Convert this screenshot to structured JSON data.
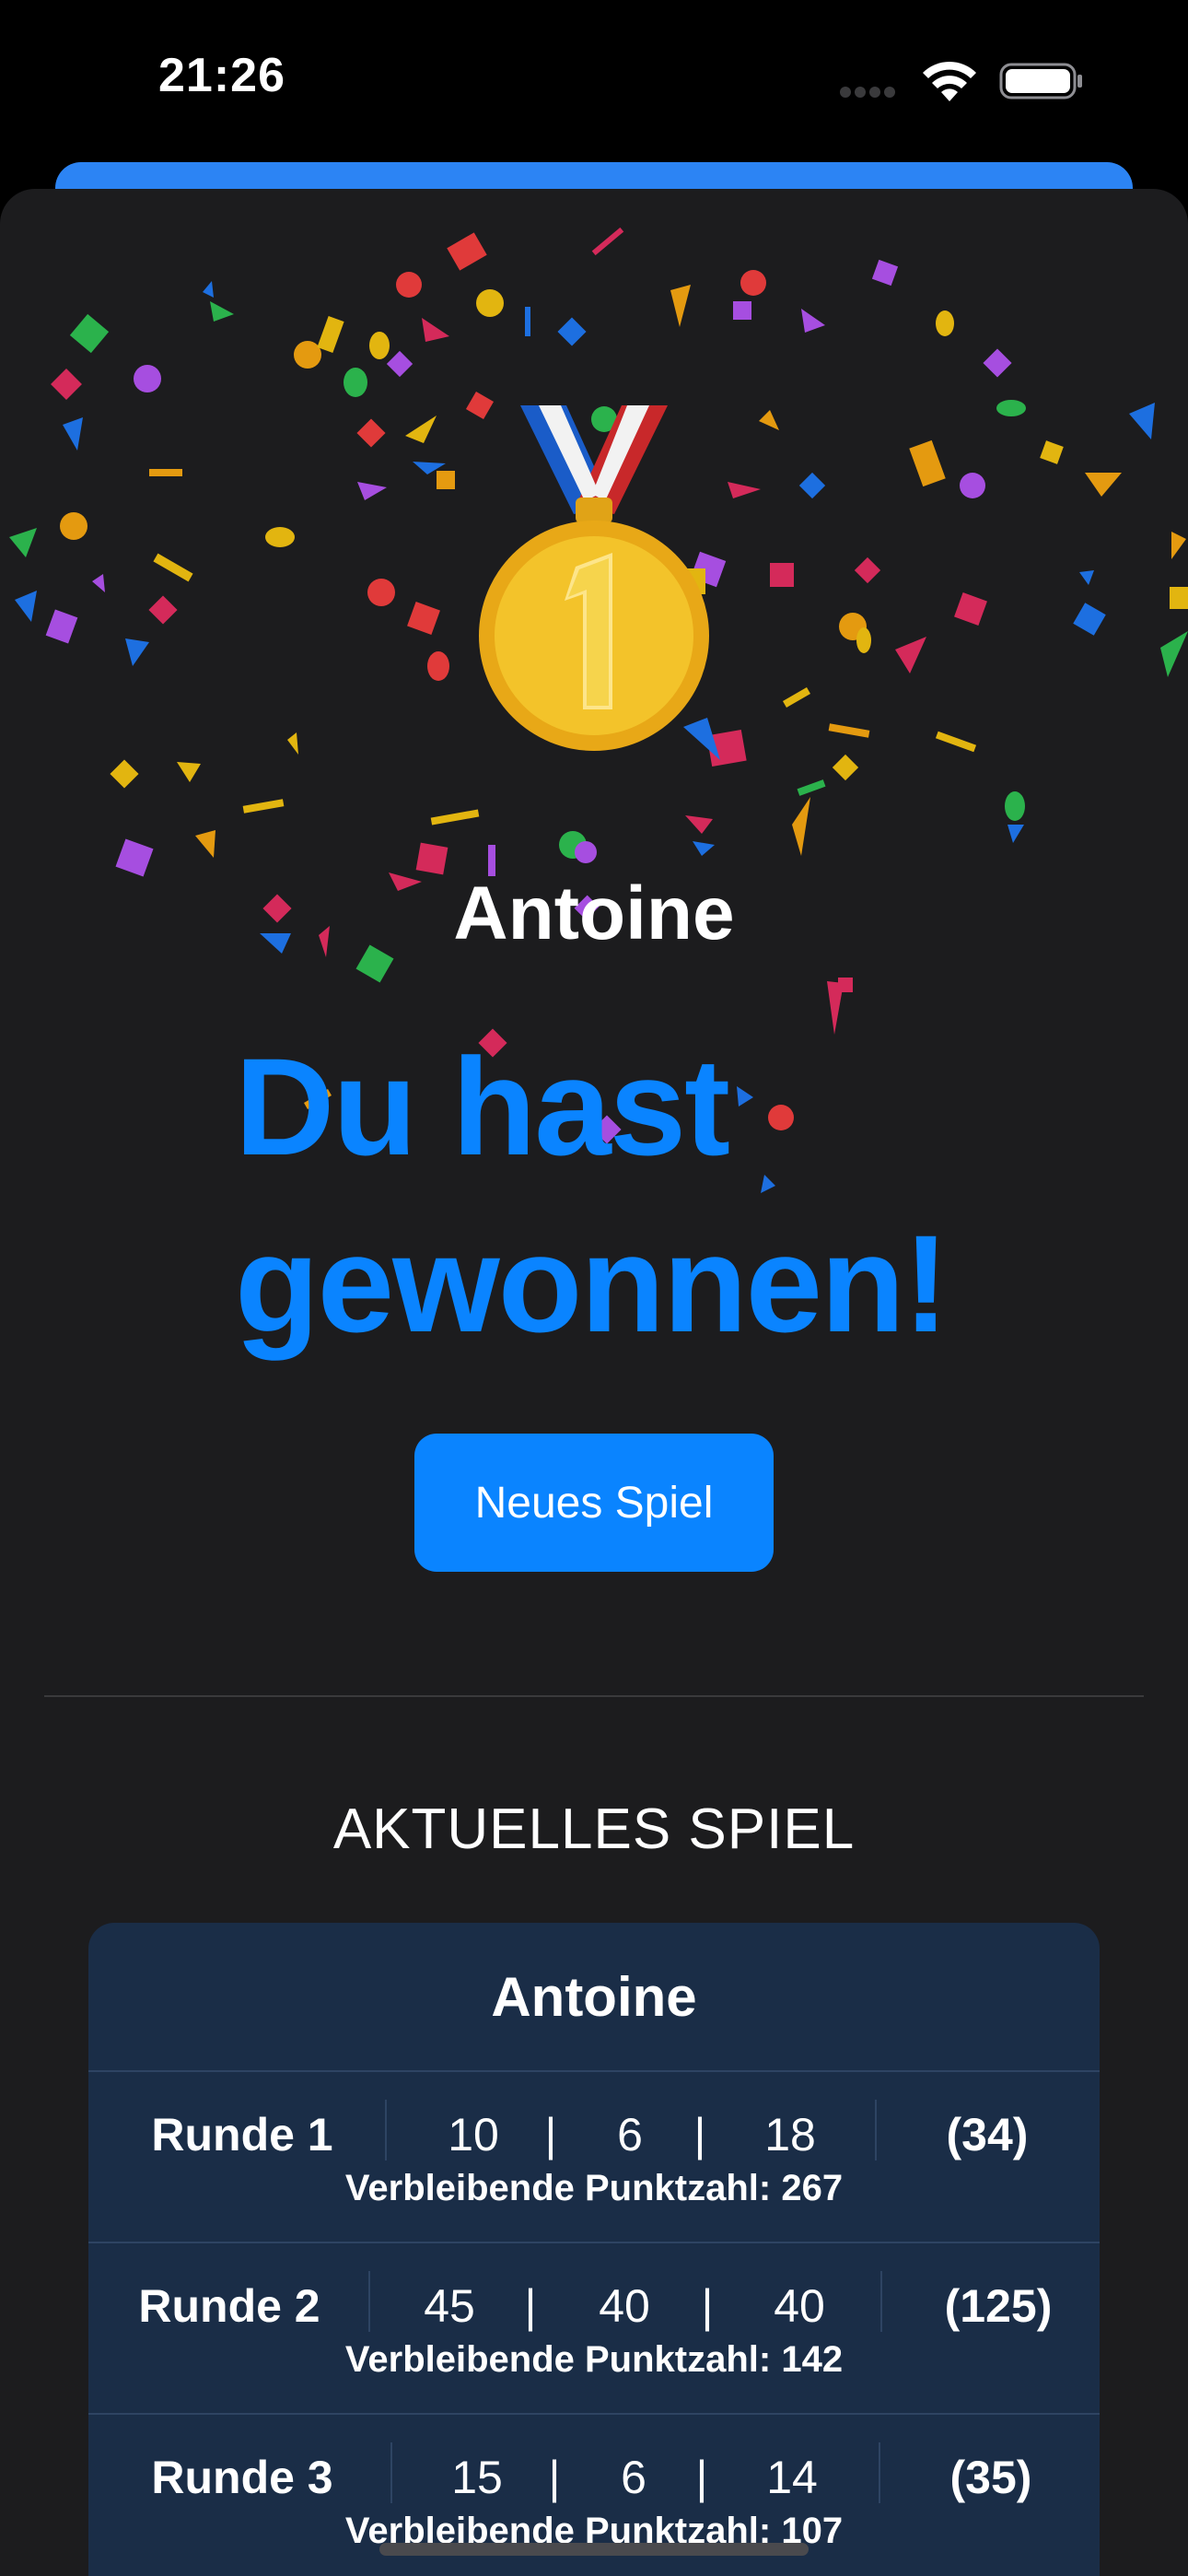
{
  "status_bar": {
    "time": "21:26"
  },
  "winner": {
    "name": "Antoine",
    "title_line1": "Du hast",
    "title_line2": "gewonnen!",
    "medal_icon": "first-place-medal-icon"
  },
  "actions": {
    "new_game_label": "Neues Spiel"
  },
  "current_game": {
    "section_title": "AKTUELLES SPIEL",
    "player": "Antoine",
    "rounds": [
      {
        "label": "Runde 1",
        "darts": [
          "10",
          "6",
          "18"
        ],
        "total": "(34)",
        "remaining": "Verbleibende Punktzahl: 267"
      },
      {
        "label": "Runde 2",
        "darts": [
          "45",
          "40",
          "40"
        ],
        "total": "(125)",
        "remaining": "Verbleibende Punktzahl: 142"
      },
      {
        "label": "Runde 3",
        "darts": [
          "15",
          "6",
          "14"
        ],
        "total": "(35)",
        "remaining": "Verbleibende Punktzahl: 107"
      }
    ],
    "separator": "|"
  },
  "colors": {
    "accent": "#0a84ff",
    "sheet_background": "#1c1c1e",
    "card_background": "#1a2d47"
  }
}
